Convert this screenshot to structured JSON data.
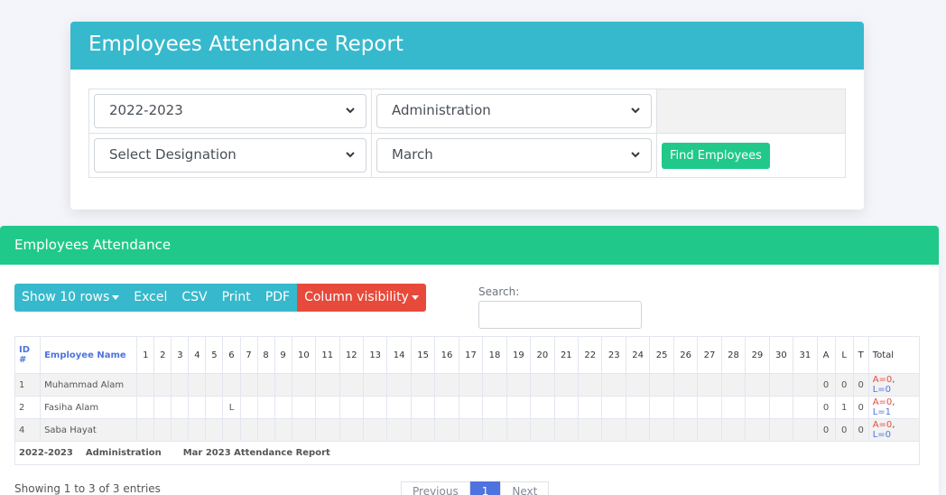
{
  "report_card": {
    "title": "Employees Attendance Report",
    "session_value": "2022-2023",
    "department_value": "Administration",
    "designation_value": "Select Designation",
    "month_value": "March",
    "find_label": "Find Employees"
  },
  "attendance_card": {
    "title": "Employees Attendance",
    "buttons": {
      "show_rows": "Show 10 rows",
      "excel": "Excel",
      "csv": "CSV",
      "print": "Print",
      "pdf": "PDF",
      "column_visibility": "Column visibility"
    },
    "search_label": "Search:",
    "columns": {
      "id": "ID #",
      "name": "Employee Name",
      "a": "A",
      "l": "L",
      "t": "T",
      "total": "Total"
    },
    "rows": [
      {
        "id": "1",
        "name": "Muhammad Alam",
        "day6": "",
        "a": "0",
        "l": "0",
        "t": "0",
        "total_a": "A=0",
        "total_l": "L=0"
      },
      {
        "id": "2",
        "name": "Fasiha Alam",
        "day6": "L",
        "a": "0",
        "l": "1",
        "t": "0",
        "total_a": "A=0",
        "total_l": "L=1"
      },
      {
        "id": "4",
        "name": "Saba Hayat",
        "day6": "",
        "a": "0",
        "l": "0",
        "t": "0",
        "total_a": "A=0",
        "total_l": "L=0"
      }
    ],
    "footer": {
      "session": "2022-2023",
      "department": "Administration",
      "report": "Mar 2023 Attendance Report"
    },
    "showing_text": "Showing 1 to 3 of 3 entries",
    "pagination": {
      "previous": "Previous",
      "page": "1",
      "next": "Next"
    }
  }
}
